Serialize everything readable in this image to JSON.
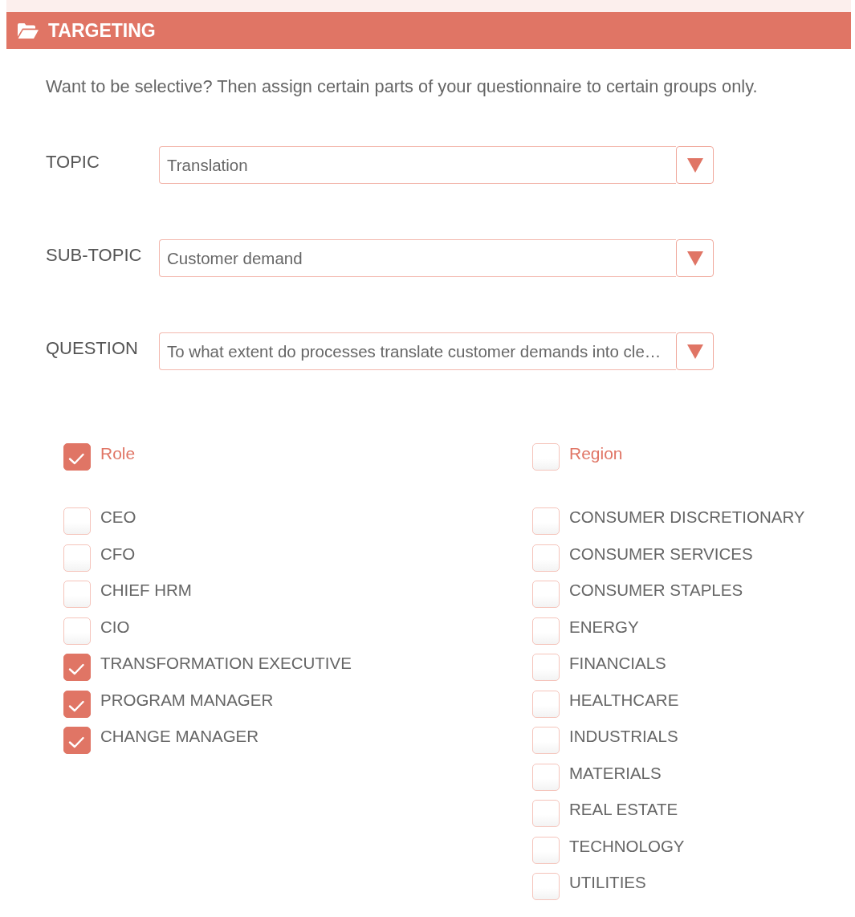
{
  "section": {
    "title": "TARGETING"
  },
  "intro": "Want to be selective? Then assign certain parts of your questionnaire to certain groups only.",
  "fields": [
    {
      "label": "TOPIC",
      "value": "Translation"
    },
    {
      "label": "SUB-TOPIC",
      "value": "Customer demand"
    },
    {
      "label": "QUESTION",
      "value": "To what extent do processes translate customer demands into cle…"
    }
  ],
  "groups": [
    {
      "label": "Role",
      "checked": true,
      "options": [
        {
          "label": "CEO",
          "checked": false
        },
        {
          "label": "CFO",
          "checked": false
        },
        {
          "label": "CHIEF HRM",
          "checked": false
        },
        {
          "label": "CIO",
          "checked": false
        },
        {
          "label": "TRANSFORMATION EXECUTIVE",
          "checked": true
        },
        {
          "label": "PROGRAM MANAGER",
          "checked": true
        },
        {
          "label": "CHANGE MANAGER",
          "checked": true
        }
      ]
    },
    {
      "label": "Region",
      "checked": false,
      "options": [
        {
          "label": "CONSUMER DISCRETIONARY",
          "checked": false
        },
        {
          "label": "CONSUMER SERVICES",
          "checked": false
        },
        {
          "label": "CONSUMER STAPLES",
          "checked": false
        },
        {
          "label": "ENERGY",
          "checked": false
        },
        {
          "label": "FINANCIALS",
          "checked": false
        },
        {
          "label": "HEALTHCARE",
          "checked": false
        },
        {
          "label": "INDUSTRIALS",
          "checked": false
        },
        {
          "label": "MATERIALS",
          "checked": false
        },
        {
          "label": "REAL ESTATE",
          "checked": false
        },
        {
          "label": "TECHNOLOGY",
          "checked": false
        },
        {
          "label": "UTILITIES",
          "checked": false
        }
      ]
    }
  ]
}
